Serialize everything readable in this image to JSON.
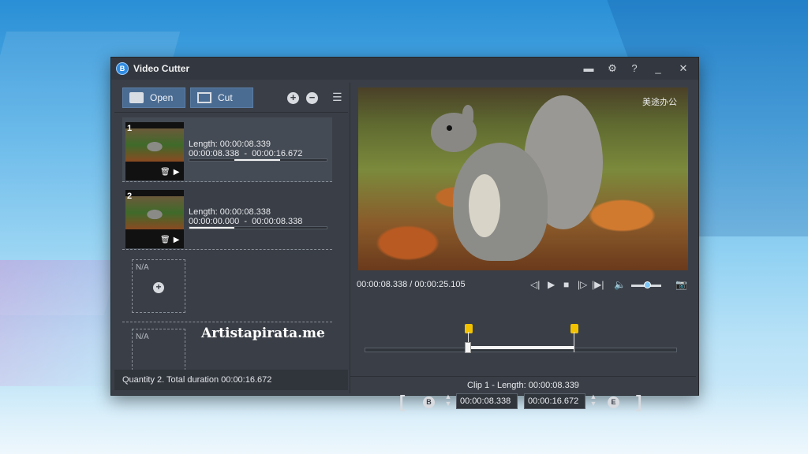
{
  "window": {
    "title": "Video Cutter",
    "app_icon_glyph": "В",
    "controls": {
      "folder": "folder-icon",
      "settings": "gear-icon",
      "help": "?",
      "minimize": "_",
      "close": "✕"
    }
  },
  "toolbar": {
    "open_label": "Open",
    "cut_label": "Cut",
    "add": "+",
    "remove": "−",
    "clear": "≡̅"
  },
  "clips": [
    {
      "number": "1",
      "length": "Length: 00:00:08.339",
      "range_start": "00:00:08.338",
      "range_sep": "-",
      "range_end": "00:00:16.672",
      "progress": 0.33,
      "progress_start": 0.33
    },
    {
      "number": "2",
      "length": "Length: 00:00:08.338",
      "range_start": "00:00:00.000",
      "range_sep": "-",
      "range_end": "00:00:08.338",
      "progress": 0.33,
      "progress_start": 0.0
    }
  ],
  "empty_slots": [
    {
      "label": "N/A"
    },
    {
      "label": "N/A"
    }
  ],
  "watermark": "Artistapirata.me",
  "status": "Quantity 2. Total duration 00:00:16.672",
  "video": {
    "watermark": "美途办公"
  },
  "player": {
    "time": "00:00:08.338 / 00:00:25.105",
    "volume": 0.55
  },
  "timeline": {
    "start_fraction": 0.33,
    "end_fraction": 0.67
  },
  "clip_editor": {
    "title": "Clip 1 - Length: 00:00:08.339",
    "begin_label": "B",
    "end_label": "E",
    "begin_time": "00:00:08.338",
    "end_time": "00:00:16.672",
    "open_bracket": "[",
    "close_bracket": "]"
  },
  "colors": {
    "accent": "#4b6c92",
    "marker": "#f2c200",
    "volume_knob": "#7dc6f5"
  }
}
